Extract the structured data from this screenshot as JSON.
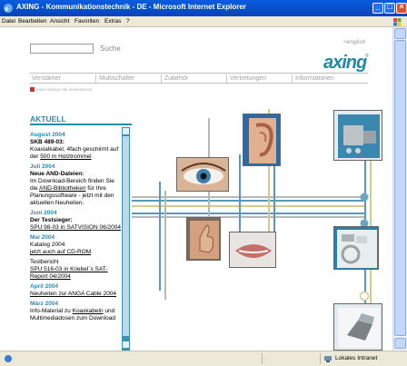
{
  "window": {
    "title": "AXING - Kommunikationstechnik - DE - Microsoft Internet Explorer"
  },
  "menu": {
    "items": [
      "Datei",
      "Bearbeiten",
      "Ansicht",
      "Favoriten",
      "Extras",
      "?"
    ]
  },
  "header": {
    "search_label": "Suche",
    "english_link": ">english",
    "logo_text": "axing",
    "logo_mark": "®"
  },
  "nav": {
    "items": [
      "Verstärker",
      "Multischalter",
      "Zubehör",
      "Vertretungen",
      "Informationen"
    ]
  },
  "site_note": "Swiss design site development",
  "aktuell": {
    "title": "AKTUELL",
    "entries": [
      {
        "date": "August 2004",
        "headline": "SKB 489-03:",
        "text": "Koaxialkabel, 4fach geschirmt auf der",
        "link": "500 m Holztrommel"
      },
      {
        "date": "Juli 2004",
        "headline": "Neue AND-Dateien:",
        "text": "Im Download-Bereich finden Sie die",
        "link": "AND-Bibliotheken",
        "text2": "für Ihre Planungssoftware - jetzt mit den aktuellen Neuheiten."
      },
      {
        "date": "Juni 2004",
        "headline": "Der Testsieger:",
        "link": "SPU 98-03 in SATVISION 06/2004"
      },
      {
        "date": "Mai 2004",
        "text": "Katalog 2004",
        "link": "jetzt auch auf CD-ROM",
        "text3": "Testbericht",
        "link2": "SPU 516-03 in Kriebel`s SAT-Report 04/2004"
      },
      {
        "date": "April 2004",
        "link": "Neuheiten zur ANGA Cable 2004"
      },
      {
        "date": "März 2004",
        "text": "Info-Material zu",
        "link": "Koaxkabeln",
        "text2": "und Multimediadosen zum Download"
      }
    ]
  },
  "statusbar": {
    "zone": "Lokales Intranet"
  },
  "colors": {
    "accent": "#2a8ab0",
    "title_bar": "#0a5ce0",
    "logo": "#1e8aa6",
    "line_blue": "#5a9ab8",
    "line_gray": "#b8b8b8",
    "line_tan": "#d8c890"
  },
  "icons": {
    "app": "ie-icon",
    "status": "page-icon",
    "zone": "intranet-icon",
    "news_bullet": "red-square-icon"
  },
  "images": [
    "eye-photo",
    "ear-photo",
    "satellite-amplifier-product-photo",
    "thumbs-up-photo",
    "lips-photo",
    "cable-connector-product-photo",
    "outlet-box-product-photo"
  ]
}
